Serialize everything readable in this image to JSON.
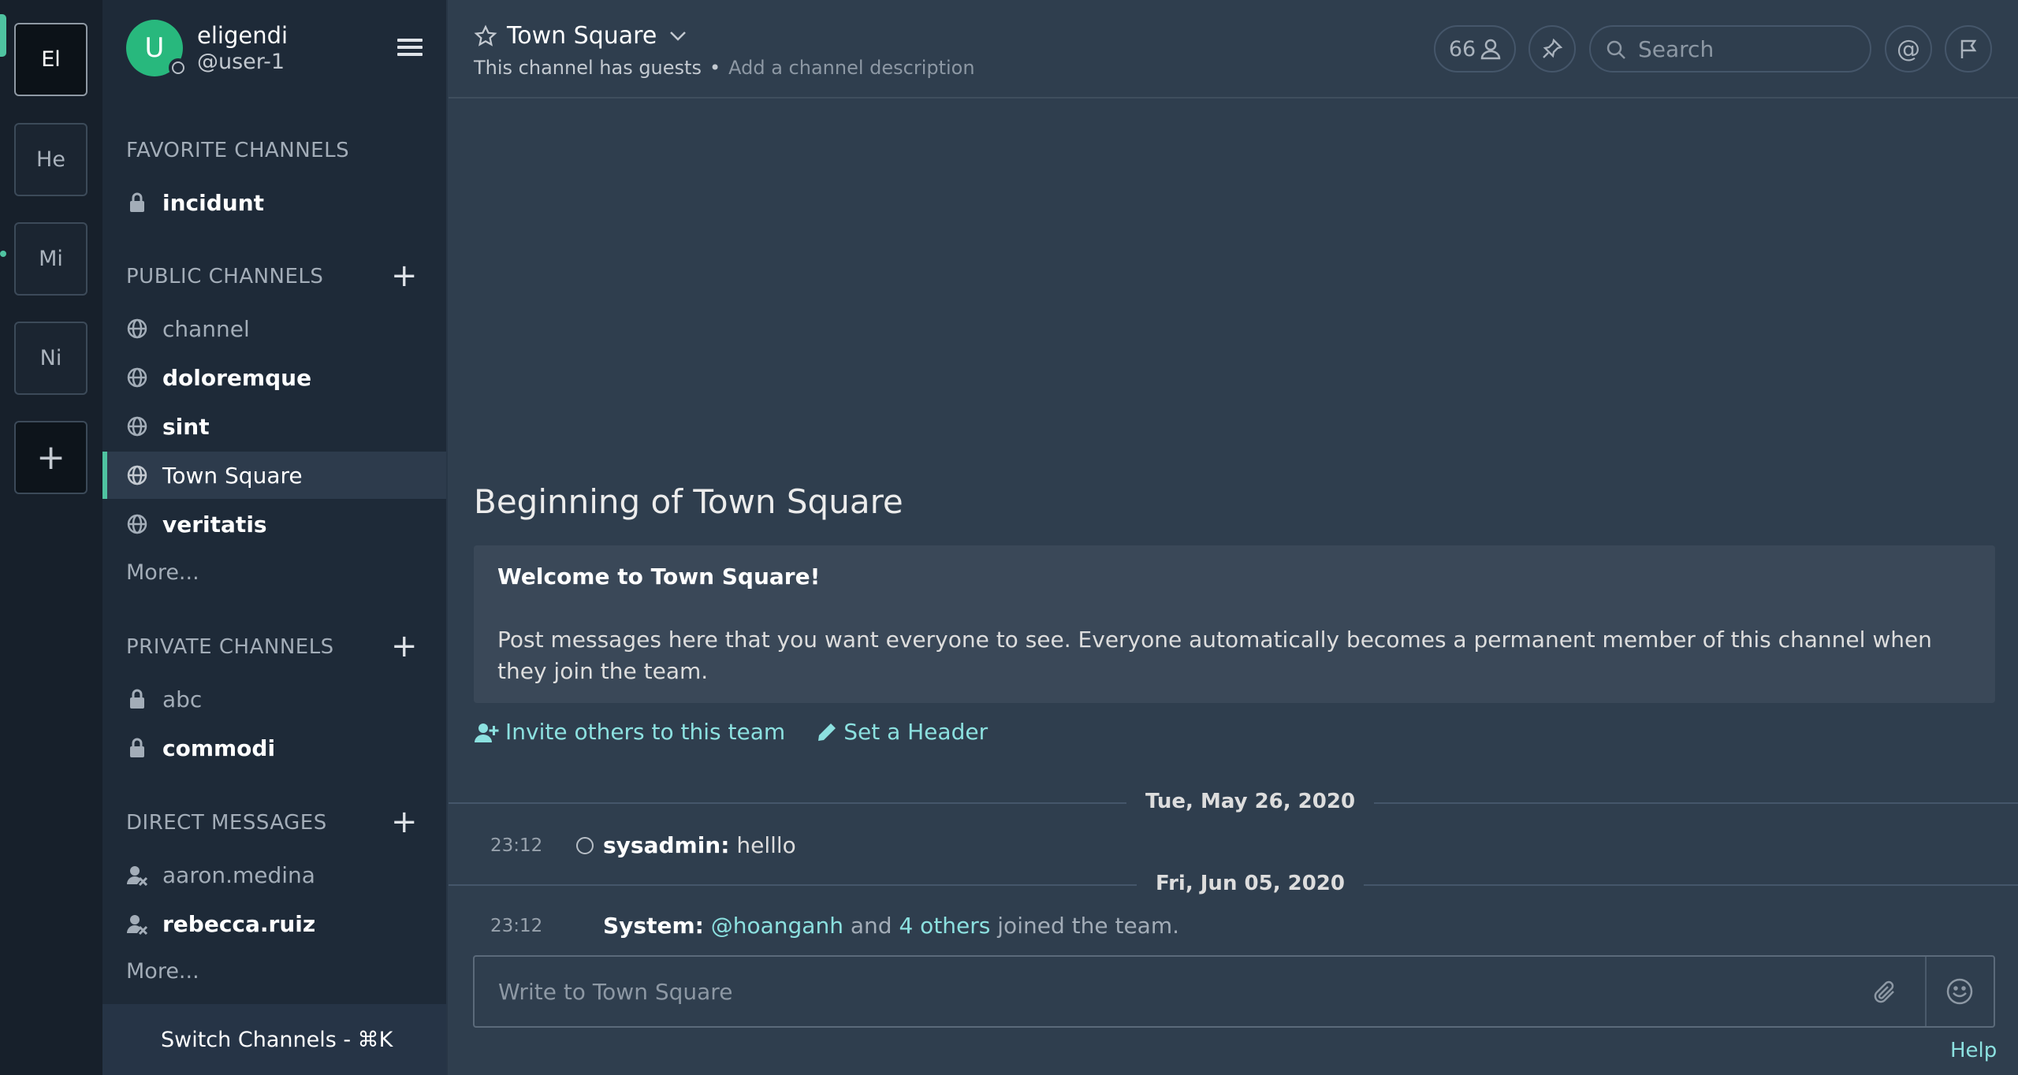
{
  "teams": [
    {
      "label": "El",
      "active": true
    },
    {
      "label": "He",
      "active": false
    },
    {
      "label": "Mi",
      "active": false
    },
    {
      "label": "Ni",
      "active": false
    }
  ],
  "team_add_label": "+",
  "user": {
    "initial": "U",
    "name": "eligendi",
    "handle": "@user-1"
  },
  "sections": {
    "favorites": {
      "title": "FAVORITE CHANNELS",
      "items": [
        {
          "label": "incidunt",
          "icon": "lock-icon"
        }
      ]
    },
    "public": {
      "title": "PUBLIC CHANNELS",
      "items": [
        {
          "label": "channel",
          "icon": "globe-icon"
        },
        {
          "label": "doloremque",
          "icon": "globe-icon"
        },
        {
          "label": "sint",
          "icon": "globe-icon"
        },
        {
          "label": "Town Square",
          "icon": "globe-icon"
        },
        {
          "label": "veritatis",
          "icon": "globe-icon"
        }
      ],
      "more": "More..."
    },
    "private": {
      "title": "PRIVATE CHANNELS",
      "items": [
        {
          "label": "abc",
          "icon": "lock-icon"
        },
        {
          "label": "commodi",
          "icon": "lock-icon"
        }
      ]
    },
    "direct": {
      "title": "DIRECT MESSAGES",
      "items": [
        {
          "label": "aaron.medina",
          "icon": "deactivated-user-icon"
        },
        {
          "label": "rebecca.ruiz",
          "icon": "deactivated-user-icon"
        }
      ],
      "more": "More..."
    }
  },
  "switch_channels": "Switch Channels - ⌘K",
  "channel": {
    "name": "Town Square",
    "guests_note": "This channel has guests",
    "separator": "•",
    "description_placeholder": "Add a channel description",
    "member_count": "66",
    "search_placeholder": "Search",
    "at_symbol": "@"
  },
  "intro": {
    "heading": "Beginning of Town Square",
    "welcome_title": "Welcome to Town Square!",
    "welcome_body": "Post messages here that you want everyone to see. Everyone automatically becomes a permanent member of this channel when they join the team.",
    "invite_label": "Invite others to this team",
    "header_label": "Set a Header"
  },
  "messages": [
    {
      "date": "Tue, May 26, 2020",
      "time": "23:12",
      "author": "sysadmin",
      "text": "helllo"
    },
    {
      "date": "Fri, Jun 05, 2020",
      "time": "23:12",
      "author": "System",
      "mention": "@hoanganh",
      "and": "and",
      "others": "4 others",
      "tail": "joined the team."
    }
  ],
  "composer_placeholder": "Write to Town Square",
  "help_label": "Help",
  "colors": {
    "accent": "#4fc3a1",
    "link": "#8ce1e0",
    "sidebar_bg": "#1e2a38",
    "center_bg": "#2f3e4e"
  }
}
